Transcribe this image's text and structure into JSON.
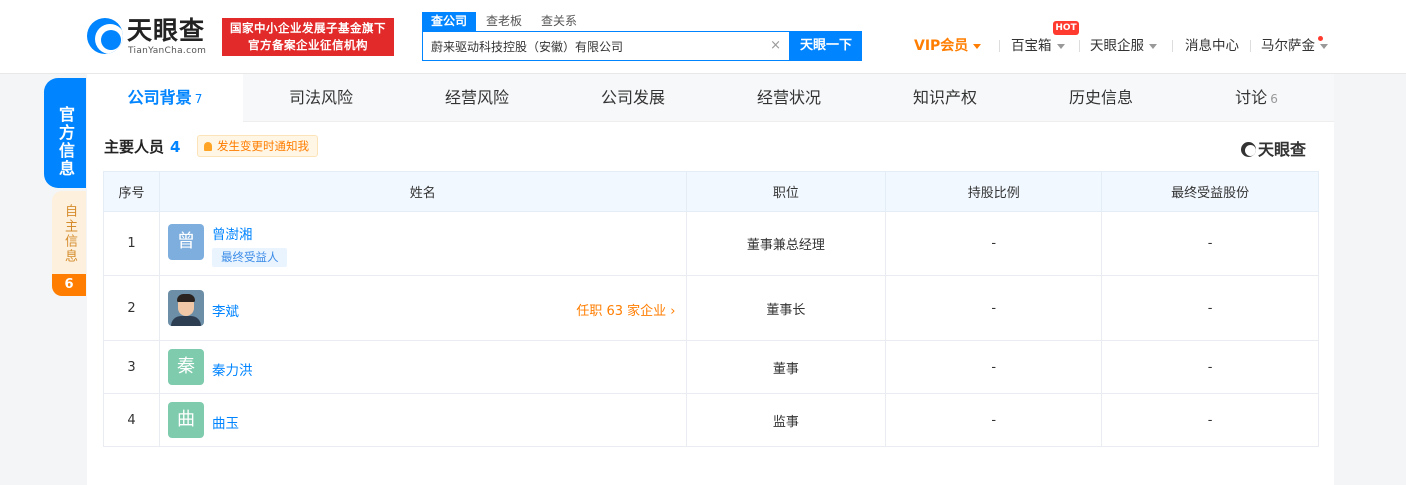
{
  "header": {
    "logo_cn": "天眼查",
    "logo_en": "TianYanCha.com",
    "banner_line1": "国家中小企业发展子基金旗下",
    "banner_line2": "官方备案企业征信机构",
    "search_tabs": [
      {
        "label": "查公司",
        "active": true
      },
      {
        "label": "查老板",
        "active": false
      },
      {
        "label": "查关系",
        "active": false
      }
    ],
    "search_value": "蔚来驱动科技控股（安徽）有限公司",
    "search_clear": "×",
    "search_button": "天眼一下",
    "nav": {
      "vip": "VIP会员",
      "baibaoxiang": "百宝箱",
      "hot_badge": "HOT",
      "qifu": "天眼企服",
      "messages": "消息中心",
      "user": "马尔萨金"
    }
  },
  "side_tabs": {
    "official": "官方信息",
    "self": "自主信息",
    "self_count": "6"
  },
  "tabs": [
    {
      "label": "公司背景",
      "count": "7",
      "active": true
    },
    {
      "label": "司法风险",
      "count": "",
      "active": false
    },
    {
      "label": "经营风险",
      "count": "",
      "active": false
    },
    {
      "label": "公司发展",
      "count": "",
      "active": false
    },
    {
      "label": "经营状况",
      "count": "",
      "active": false
    },
    {
      "label": "知识产权",
      "count": "",
      "active": false
    },
    {
      "label": "历史信息",
      "count": "",
      "active": false
    },
    {
      "label": "讨论",
      "count": "6",
      "active": false
    }
  ],
  "section": {
    "title": "主要人员",
    "count": "4",
    "notify_label": "发生变更时通知我",
    "watermark": "天眼查"
  },
  "table": {
    "headers": [
      "序号",
      "姓名",
      "职位",
      "持股比例",
      "最终受益股份"
    ],
    "rows": [
      {
        "no": "1",
        "avatar_char": "曾",
        "avatar_color": "#7eaede",
        "name": "曾澍湘",
        "tag": "最终受益人",
        "jobs": "",
        "position": "董事兼总经理",
        "share": "-",
        "final_share": "-"
      },
      {
        "no": "2",
        "avatar_char": "",
        "avatar_color": "#6c8ea6",
        "name": "李斌",
        "tag": "",
        "jobs": "任职 63 家企业",
        "position": "董事长",
        "share": "-",
        "final_share": "-"
      },
      {
        "no": "3",
        "avatar_char": "秦",
        "avatar_color": "#7fcbae",
        "name": "秦力洪",
        "tag": "",
        "jobs": "",
        "position": "董事",
        "share": "-",
        "final_share": "-"
      },
      {
        "no": "4",
        "avatar_char": "曲",
        "avatar_color": "#7fcbae",
        "name": "曲玉",
        "tag": "",
        "jobs": "",
        "position": "监事",
        "share": "-",
        "final_share": "-"
      }
    ]
  }
}
